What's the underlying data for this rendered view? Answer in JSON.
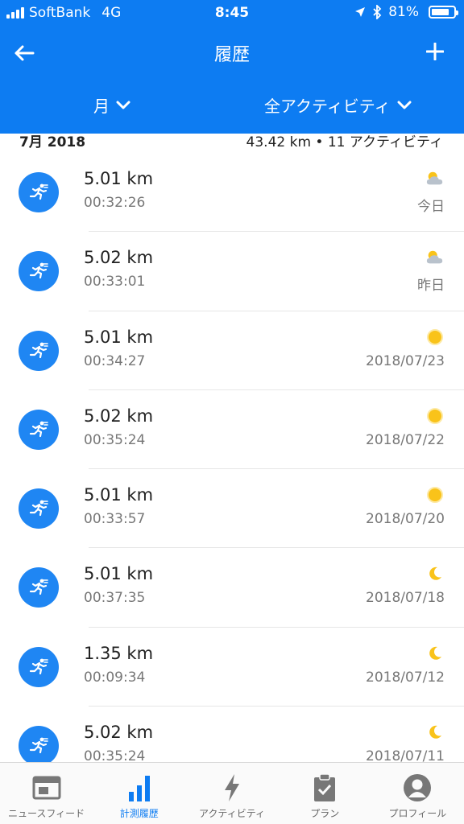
{
  "status_bar": {
    "carrier": "SoftBank",
    "network": "4G",
    "time": "8:45",
    "battery_percent": "81%",
    "battery_level": 0.81
  },
  "navbar": {
    "back_icon": "arrow-left-icon",
    "title": "履歴",
    "add_icon": "plus-icon"
  },
  "filters": {
    "period_label": "月",
    "activity_label": "全アクティビティ"
  },
  "summary": {
    "month": "7月 2018",
    "stats": "43.42 km • 11 アクティビティ"
  },
  "activities": [
    {
      "distance": "5.01 km",
      "duration": "00:32:26",
      "date": "今日",
      "weather": "partly-cloudy-icon"
    },
    {
      "distance": "5.02 km",
      "duration": "00:33:01",
      "date": "昨日",
      "weather": "partly-cloudy-icon"
    },
    {
      "distance": "5.01 km",
      "duration": "00:34:27",
      "date": "2018/07/23",
      "weather": "sun-icon"
    },
    {
      "distance": "5.02 km",
      "duration": "00:35:24",
      "date": "2018/07/22",
      "weather": "sun-icon"
    },
    {
      "distance": "5.01 km",
      "duration": "00:33:57",
      "date": "2018/07/20",
      "weather": "sun-icon"
    },
    {
      "distance": "5.01 km",
      "duration": "00:37:35",
      "date": "2018/07/18",
      "weather": "moon-icon"
    },
    {
      "distance": "1.35 km",
      "duration": "00:09:34",
      "date": "2018/07/12",
      "weather": "moon-icon"
    },
    {
      "distance": "5.02 km",
      "duration": "00:35:24",
      "date": "2018/07/11",
      "weather": "moon-icon"
    }
  ],
  "tabbar": {
    "tabs": [
      {
        "label": "ニュースフィード",
        "icon": "newsfeed-icon",
        "active": false
      },
      {
        "label": "計測履歴",
        "icon": "bar-chart-icon",
        "active": true
      },
      {
        "label": "アクティビティ",
        "icon": "lightning-icon",
        "active": false
      },
      {
        "label": "プラン",
        "icon": "clipboard-check-icon",
        "active": false
      },
      {
        "label": "プロフィール",
        "icon": "profile-icon",
        "active": false
      }
    ]
  },
  "colors": {
    "brand_blue": "#0d7cf2",
    "run_icon_blue": "#1f86f3",
    "sun_yellow": "#f9c31a",
    "cloud_gray": "#b9c2cc",
    "tab_inactive": "#777777"
  }
}
